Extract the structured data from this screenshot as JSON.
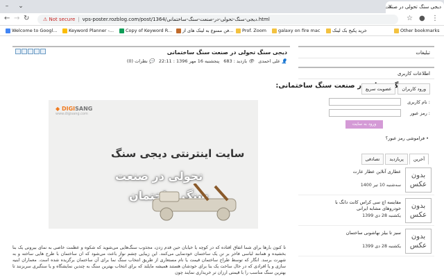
{
  "browser": {
    "tab_title": "دیجی سنگ تحولی در صنعت سنگ ساختمانی",
    "security_label": "Not secure",
    "url": "vps-poster.rozblog.com/post/1364/دیجی-سنگ-تحولی-در-صنعت-سنگ-ساختمانی.html",
    "bookmarks": [
      {
        "label": "Welcome to Googl...",
        "icon": "google-icon",
        "color": "#4285f4"
      },
      {
        "label": "Keyword Planner -...",
        "icon": "google-ads-icon",
        "color": "#fbbc04"
      },
      {
        "label": "Copy of Keyword R...",
        "icon": "sheets-icon",
        "color": "#0f9d58"
      },
      {
        "label": "فن ممنوع به لینک های از...",
        "icon": "site-icon",
        "color": "#c06a2b"
      },
      {
        "label": "Prof. Zoom",
        "icon": "folder-icon",
        "color": "#f3c240"
      },
      {
        "label": "galaxy on fire mac",
        "icon": "folder-icon",
        "color": "#f3c240"
      },
      {
        "label": "خرید پکیج بک لینک",
        "icon": "folder-icon",
        "color": "#f3c240"
      },
      {
        "label": "Other bookmarks",
        "icon": "folder-icon",
        "color": "#f3c240"
      }
    ]
  },
  "post": {
    "title": "دیجی سنگ تحولی در صنعت سنگ ساختمانی",
    "author": "علی احمدی",
    "views": "بازدید : 683",
    "date": "پنجشنبه 16 مهر 1396 : 22:11",
    "comments": "نظرات (0)",
    "subtitle": "دیجی سنگ تحولی در صنعت سنگ ساختمانی:",
    "banner": {
      "brand_digi": "DIGI",
      "brand_sang": "SANG",
      "brand_url": "www.digisang.com",
      "line1": "سایت اینترنتی دیجی سنگ",
      "line2": "تحولی در صنعت",
      "line3": "سنگ ساختمان"
    },
    "body": "تا کنون بارها برای شما اتفاق افتاده که در کوچه یا خیابان حین قدم زدن، مجذوب سنگ‌هایی می‌شوید که شکوه و عظمت خاصی به نمای بیرونی یک بنا بخشیده و همانند لباسی فاخر بر تن یک ساختمان خودنمایی می‌کنند. این زیبایی چشم نواز باعث می‌شود که ان ساختمان با طرح هایی ساخته و به شهرت برسد. انگار که توسط طراح ساختمان قیمت یا نام مستعاری از طریق انتخاب سنگ نما برای آن ساختمان برگزیده شده است. معماران ابنیه سازی و یا افرادی که در حال ساخت یک بنا برای خودشان هستند همیشه مایلند که برای انتخاب بهترین سنگ به چندین نمایشگاه و یا سنگبری سربزنند تا بهترین سنگ مناسب را با قیمتی ارزان تر خریداری نمایند چون"
  },
  "sidebar": {
    "ads_title": "تبلیغات",
    "login_title": "اطلاعات کاربری",
    "login_tabs": [
      "ورود کاربران",
      "عضویت سریع"
    ],
    "username_label": "نام کاربری :",
    "password_label": "رمز عبور :",
    "submit_label": "ورود به سایت",
    "forgot_label": "فراموشی رمز عبور؟",
    "post_tabs": [
      "آخرین",
      "پربازدید",
      "تصادفی"
    ],
    "no_image": "بدون عکس",
    "recent_posts": [
      {
        "title": "عطاری آنلاین عطار عارت",
        "date": "سه‌شنبه 10 تیر 1400"
      },
      {
        "title": "مقایسه اچ سی کراس کانت دانگ با خودروهای مشابه ایرانی",
        "date": "یکشنبه 28 دی 1399"
      },
      {
        "title": "سبز تا بیلز نهاشونی ساختمان",
        "date": "یکشنبه 28 دی 1399"
      }
    ]
  }
}
